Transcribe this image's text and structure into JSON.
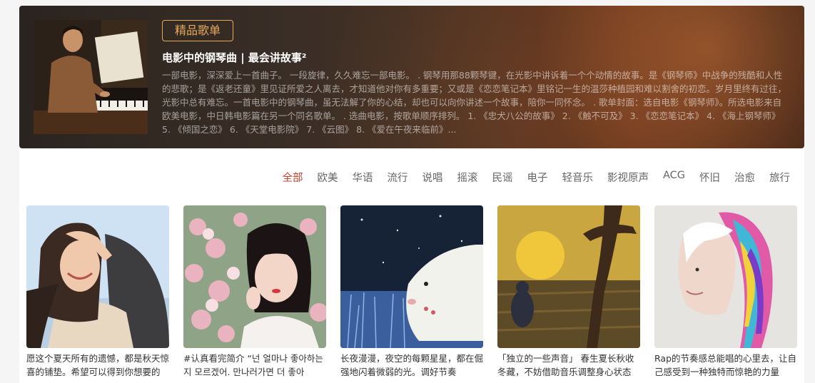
{
  "banner": {
    "badge": "精品歌单",
    "title": "电影中的钢琴曲 | 最会讲故事²",
    "description": "一部电影，深深爱上一首曲子。 一段旋律，久久难忘一部电影。 . 钢琴用那88颗琴键，在光影中讲诉着一个个动情的故事。是《钢琴师》中战争的残酷和人性的悲歌；是《返老还童》里见证所爱之人离去，才知道他对你有多重要；又或是《恋恋笔记本》里铭记一生的温莎种植园和难以割舍的初恋。岁月里终有过往，光影中总有难忘。一首电影中的钢琴曲，虽无法解了你的心结，却也可以向你讲述一个故事，陪你一同怀念。 . 歌单封面：选自电影《钢琴师》。所选电影来自欧美电影，中日韩电影篇在另一个同名歌单。 . 选曲电影，按歌单顺序排列。 1. 《忠犬八公的故事》 2. 《触不可及》 3. 《恋恋笔记本》 4. 《海上钢琴师》 5. 《倾国之恋》 6. 《天堂电影院》 7. 《云图》 8. 《爱在午夜来临前》..."
  },
  "categories": [
    "全部",
    "欧美",
    "华语",
    "流行",
    "说唱",
    "摇滚",
    "民谣",
    "电子",
    "轻音乐",
    "影视原声",
    "ACG",
    "怀旧",
    "治愈",
    "旅行"
  ],
  "active_category": "全部",
  "playlists": [
    {
      "title": "愿这个夏天所有的遗憾，都是秋天惊喜的铺垫。希望可以得到你想要的"
    },
    {
      "title": "#认真看完简介 “넌 얼마나 좋아하는지 모르겠어. 만나러가면 더 좋아"
    },
    {
      "title": "长夜漫漫，夜空的每颗星星，都在倔强地闪着微弱的光。调好节奏"
    },
    {
      "title": "「独立的一些声音」 春生夏长秋收冬藏，不妨借助音乐调整身心状态"
    },
    {
      "title": "Rap的节奏感总能唱的心里去，让自己感受到一种独特而惊艳的力量"
    }
  ]
}
